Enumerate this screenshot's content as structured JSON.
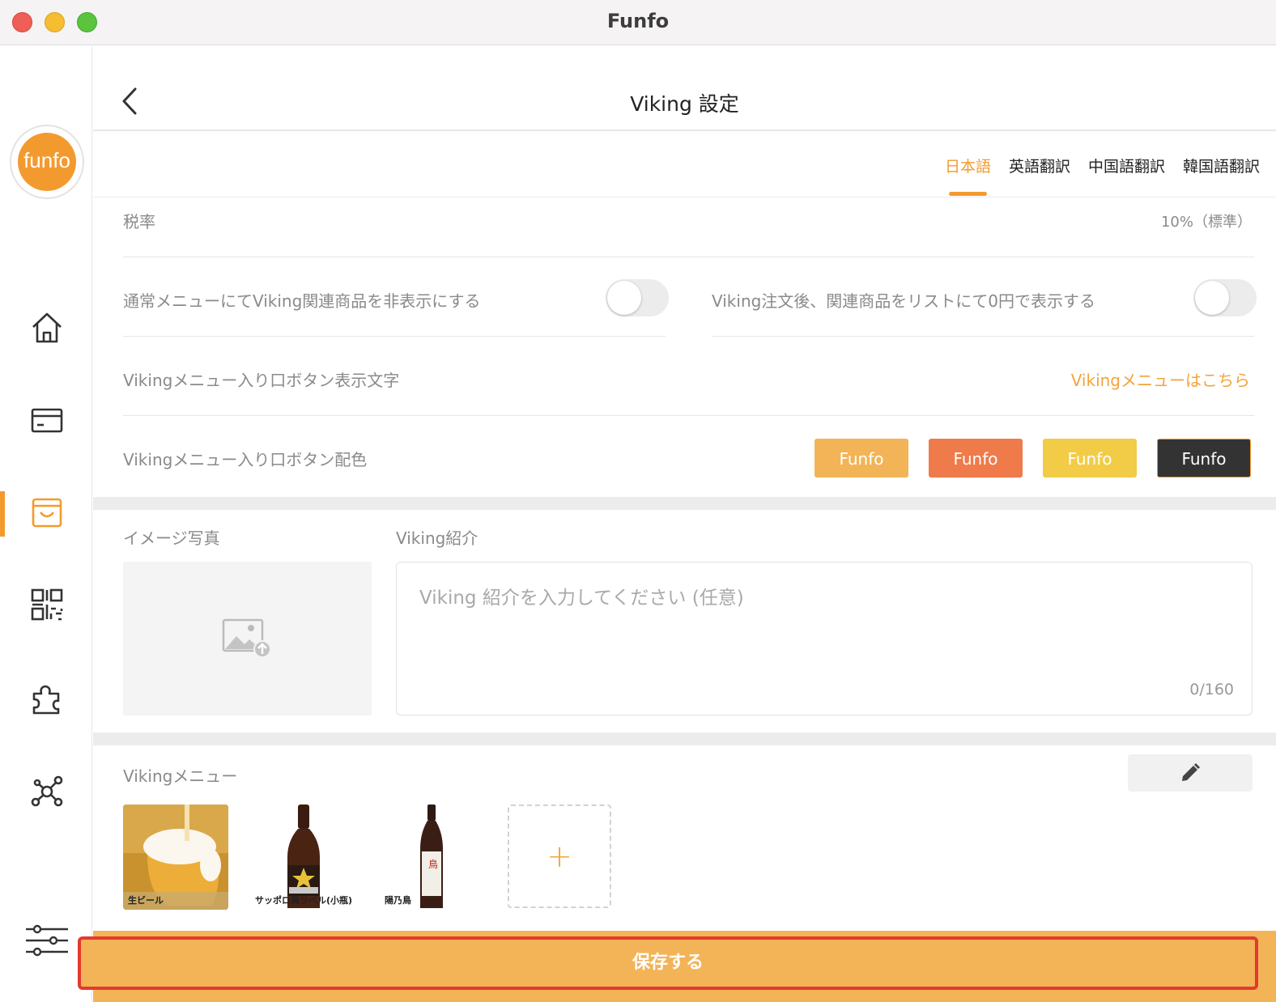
{
  "window": {
    "title": "Funfo"
  },
  "sidebar": {
    "logo_text": "funfo",
    "items": [
      {
        "name": "home-icon"
      },
      {
        "name": "card-icon"
      },
      {
        "name": "shopping-bag-icon",
        "active": true
      },
      {
        "name": "qr-code-icon"
      },
      {
        "name": "puzzle-icon"
      },
      {
        "name": "network-icon"
      },
      {
        "name": "settings-sliders-icon"
      }
    ]
  },
  "header": {
    "title": "Viking 設定"
  },
  "tabs": [
    {
      "label": "日本語",
      "active": true
    },
    {
      "label": "英語翻訳"
    },
    {
      "label": "中国語翻訳"
    },
    {
      "label": "韓国語翻訳"
    }
  ],
  "settings": {
    "tax_label": "税率",
    "tax_value": "10%（標準）",
    "hide_related_label": "通常メニューにてViking関連商品を非表示にする",
    "hide_related_on": false,
    "zero_yen_label": "Viking注文後、関連商品をリストにて0円で表示する",
    "zero_yen_on": false,
    "entry_text_label": "Vikingメニュー入り口ボタン表示文字",
    "entry_text_value": "Vikingメニューはこちら",
    "entry_color_label": "Vikingメニュー入り口ボタン配色",
    "color_options": [
      {
        "label": "Funfo",
        "color": "#f2b457"
      },
      {
        "label": "Funfo",
        "color": "#ef7a4a"
      },
      {
        "label": "Funfo",
        "color": "#f2cc47"
      },
      {
        "label": "Funfo",
        "color": "#333333",
        "selected": true
      }
    ]
  },
  "intro": {
    "photo_label": "イメージ写真",
    "intro_label": "Viking紹介",
    "placeholder": "Viking 紹介を入力してください (任意)",
    "count": "0/160"
  },
  "viking_menu": {
    "label": "Vikingメニュー",
    "items": [
      {
        "caption": "生ビール"
      },
      {
        "caption": "サッポロ黒ラベル(小瓶)"
      },
      {
        "caption": "陽乃鳥"
      }
    ],
    "add_symbol": "+"
  },
  "save_label": "保存する",
  "colors": {
    "accent": "#f39a2f",
    "save_bg": "#f2b457",
    "highlight_border": "#e23a2f"
  }
}
